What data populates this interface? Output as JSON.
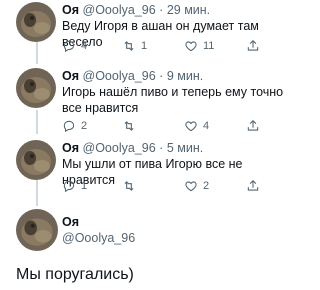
{
  "tweets": [
    {
      "name": "Оя",
      "handle": "@Ooolya_96",
      "dot": "·",
      "time": "29 мин.",
      "text": "Веду Игоря в ашан он думает там весело",
      "reply_count": "4",
      "retweet_count": "1",
      "like_count": "11",
      "share_count": ""
    },
    {
      "name": "Оя",
      "handle": "@Ooolya_96",
      "dot": "·",
      "time": "9 мин.",
      "text": "Игорь нашёл пиво и теперь ему точно все нравится",
      "reply_count": "2",
      "retweet_count": "",
      "like_count": "4",
      "share_count": ""
    },
    {
      "name": "Оя",
      "handle": "@Ooolya_96",
      "dot": "·",
      "time": "5 мин.",
      "text": "Мы ушли от пива Игорю все не нравится",
      "reply_count": "1",
      "retweet_count": "",
      "like_count": "2",
      "share_count": ""
    }
  ],
  "main_tweet": {
    "name": "Оя",
    "handle": "@Ooolya_96",
    "text": "Мы поругались)"
  },
  "icons": {
    "reply": "reply-icon",
    "retweet": "retweet-icon",
    "like": "heart-icon",
    "share": "share-icon"
  },
  "colors": {
    "text": "#0f1419",
    "secondary": "#536471",
    "thread_line": "#cfd9de"
  }
}
